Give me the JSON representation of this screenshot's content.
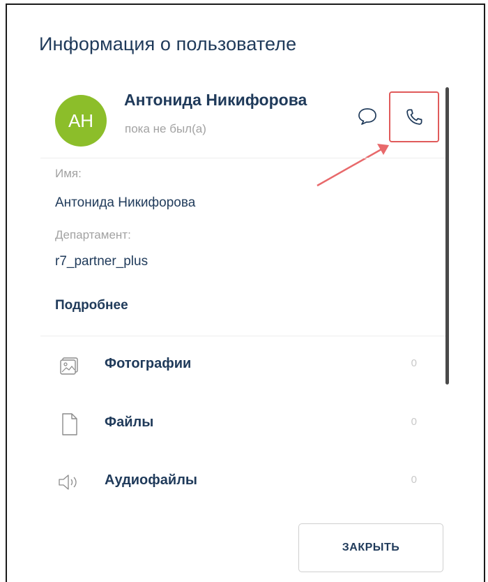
{
  "dialog": {
    "title": "Информация о пользователе",
    "close_label": "ЗАКРЫТЬ"
  },
  "user": {
    "initials": "АН",
    "name": "Антонида Никифорова",
    "status": "пока не был(а)",
    "avatar_color": "#8cbe2a"
  },
  "fields": [
    {
      "label": "Имя:",
      "value": "Антонида Никифорова"
    },
    {
      "label": "Департамент:",
      "value": "r7_partner_plus"
    }
  ],
  "more_link": "Подробнее",
  "media": [
    {
      "icon": "photo-icon",
      "label": "Фотографии",
      "count": "0"
    },
    {
      "icon": "file-icon",
      "label": "Файлы",
      "count": "0"
    },
    {
      "icon": "audio-icon",
      "label": "Аудиофайлы",
      "count": "0"
    }
  ],
  "colors": {
    "primary_text": "#1f3a5a",
    "muted_text": "#a2a2a2",
    "highlight": "#e05a5a"
  }
}
